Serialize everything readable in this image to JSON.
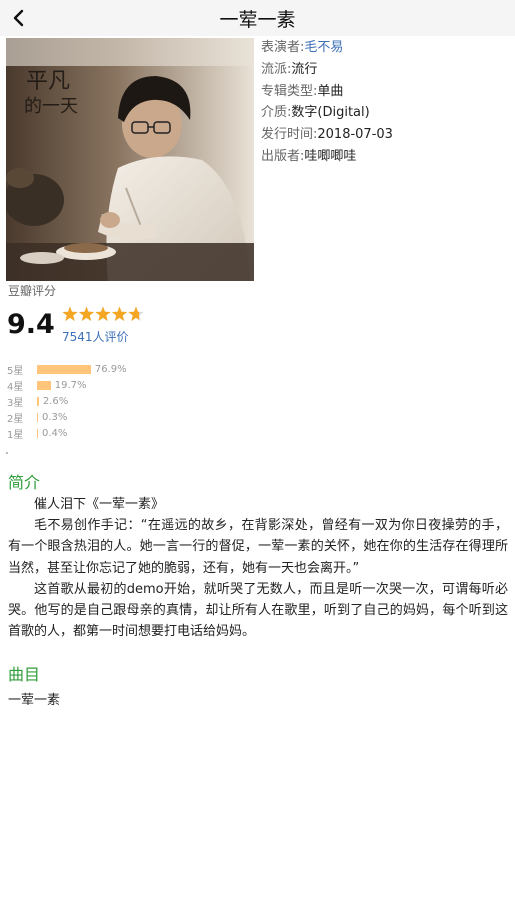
{
  "header": {
    "title": "一荤一素"
  },
  "cover": {
    "handwriting": "平凡的一天"
  },
  "info": {
    "performer_label": "表演者:",
    "performer": "毛不易",
    "genre_label": "流派:",
    "genre": "流行",
    "album_type_label": "专辑类型:",
    "album_type": "单曲",
    "medium_label": "介质:",
    "medium": "数字(Digital)",
    "release_label": "发行时间:",
    "release": "2018-07-03",
    "publisher_label": "出版者:",
    "publisher": "哇唧唧哇"
  },
  "rating": {
    "label": "豆瓣评分",
    "score": "9.4",
    "stars_fraction": 0.94,
    "votes": "7541人评价",
    "distribution": [
      {
        "label": "5星",
        "percent": "76.9%",
        "value": 76.9
      },
      {
        "label": "4星",
        "percent": "19.7%",
        "value": 19.7
      },
      {
        "label": "3星",
        "percent": "2.6%",
        "value": 2.6
      },
      {
        "label": "2星",
        "percent": "0.3%",
        "value": 0.3
      },
      {
        "label": "1星",
        "percent": "0.4%",
        "value": 0.4
      }
    ]
  },
  "intro": {
    "title": "简介",
    "paragraphs": [
      "催人泪下《一荤一素》",
      "毛不易创作手记：“在遥远的故乡，在背影深处，曾经有一双为你日夜操劳的手，有一个眼含热泪的人。她一言一行的督促，一荤一素的关怀，她在你的生活存在得理所当然，甚至让你忘记了她的脆弱，还有，她有一天也会离开。”",
      "这首歌从最初的demo开始，就听哭了无数人，而且是听一次哭一次，可谓每听必哭。他写的是自己跟母亲的真情，却让所有人在歌里，听到了自己的妈妈，每个听到这首歌的人，都第一时间想要打电话给妈妈。"
    ]
  },
  "tracks": {
    "title": "曲目",
    "items": [
      "一荤一素"
    ]
  },
  "colors": {
    "accent_green": "#2e9d3a",
    "link_blue": "#3d70b8",
    "star_orange": "#f5a623",
    "bar_orange": "#ffc57a"
  }
}
